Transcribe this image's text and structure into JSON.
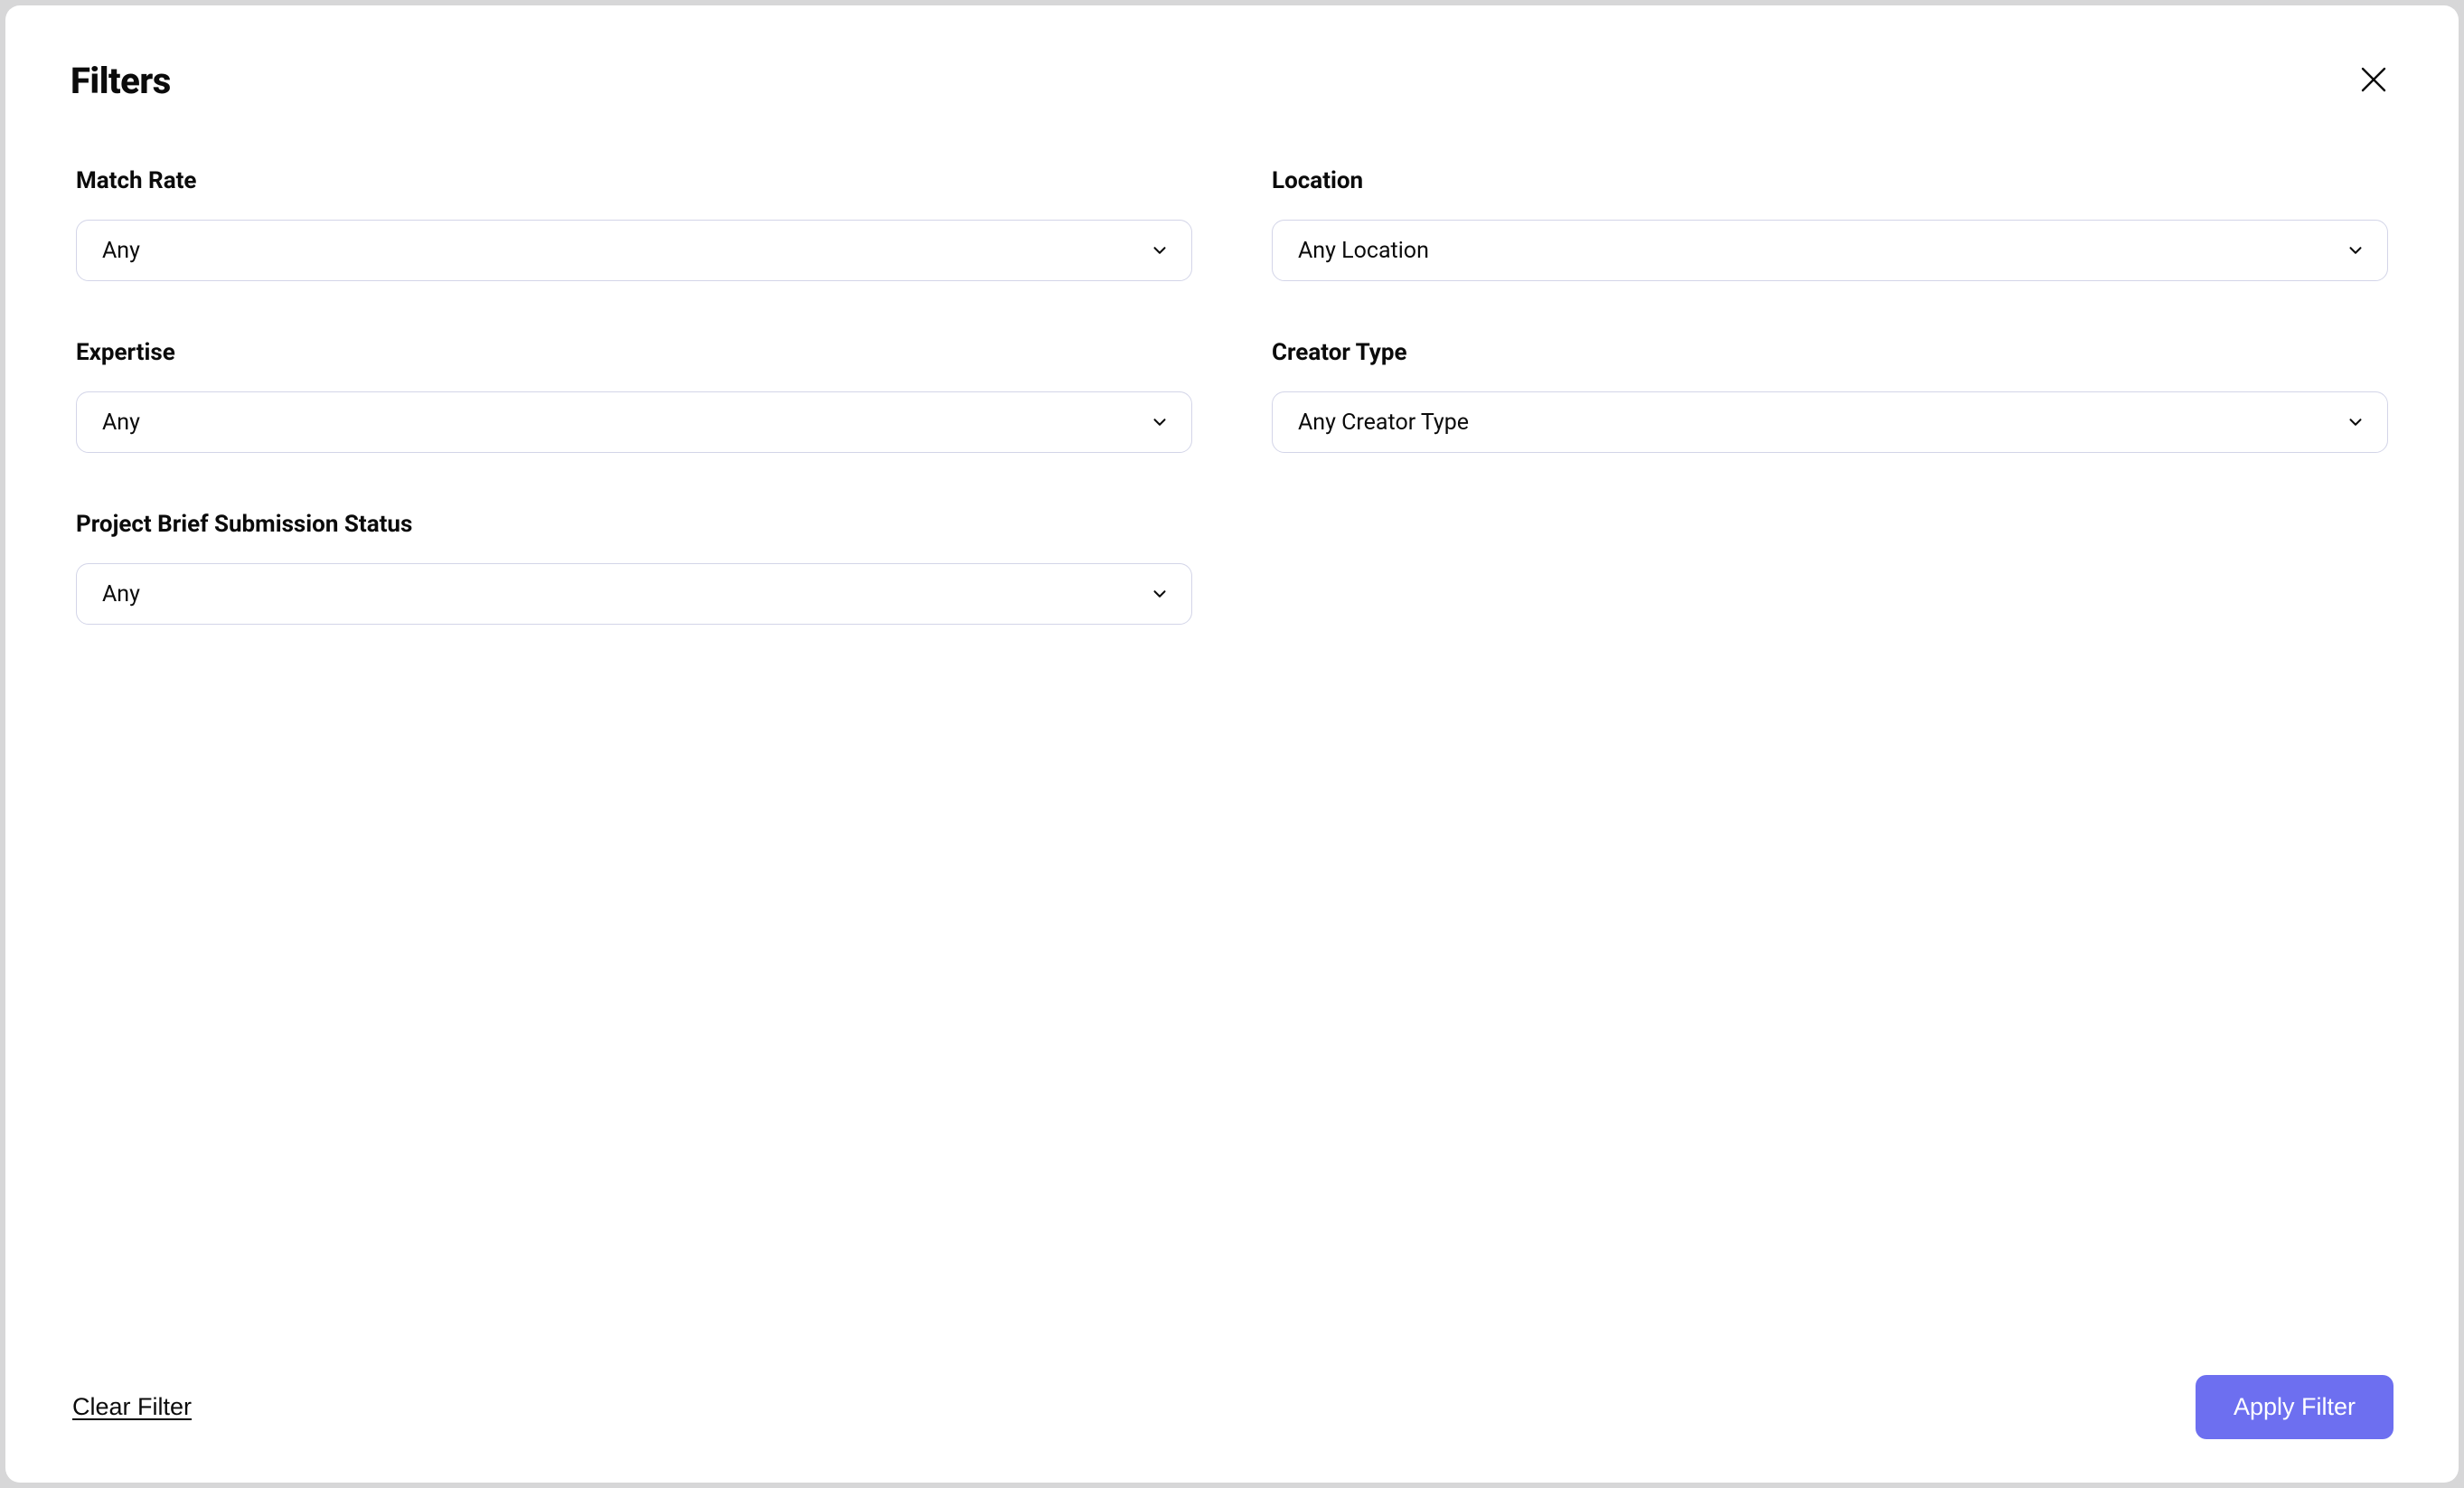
{
  "modal": {
    "title": "Filters",
    "fields": {
      "match_rate": {
        "label": "Match Rate",
        "value": "Any"
      },
      "location": {
        "label": "Location",
        "value": "Any Location"
      },
      "expertise": {
        "label": "Expertise",
        "value": "Any"
      },
      "creator_type": {
        "label": "Creator Type",
        "value": "Any Creator Type"
      },
      "submission_status": {
        "label": "Project Brief Submission Status",
        "value": "Any"
      }
    },
    "actions": {
      "clear": "Clear Filter",
      "apply": "Apply Filter"
    }
  }
}
